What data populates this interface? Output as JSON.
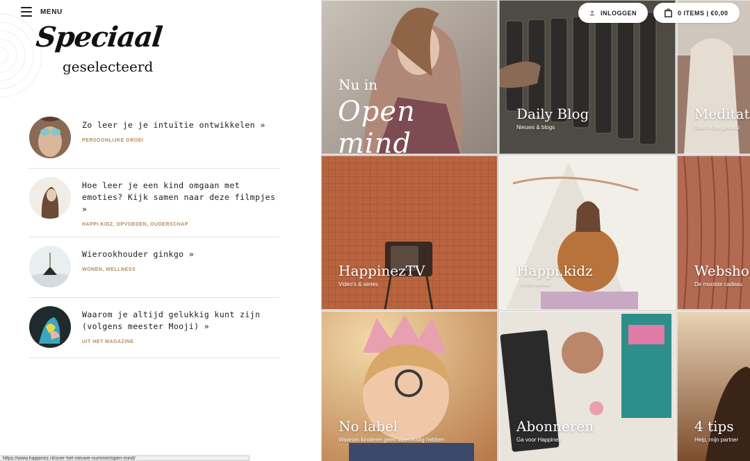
{
  "menu": {
    "label": "MENU"
  },
  "logo": {
    "line1": "Speciaal",
    "line2": "geselecteerd"
  },
  "articles": [
    {
      "title": "Zo leer je je intuïtie ontwikkelen »",
      "tags": "PERSOONLIJKE GROEI"
    },
    {
      "title": "Hoe leer je een kind omgaan met emoties? Kijk samen naar deze filmpjes »",
      "tags": "HAPPI.KIDZ, OPVOEDEN, OUDERSCHAP"
    },
    {
      "title": "Wierookhouder ginkgo »",
      "tags": "WONEN, WELLNESS"
    },
    {
      "title": "Waarom je altijd gelukkig kunt zijn (volgens meester Mooji) »",
      "tags": "UIT HET MAGAZINE"
    }
  ],
  "header": {
    "login_label": "INLOGGEN",
    "cart_label": "0 ITEMS | €0,00"
  },
  "tiles": {
    "open_mind": {
      "line1": "Nu in",
      "line2": "Open mind"
    },
    "daily_blog": {
      "title": "Daily Blog",
      "sub": "Nieuws & blogs"
    },
    "meditatie": {
      "title": "Meditati",
      "sub": "Start nu je gratis p"
    },
    "happinez_tv": {
      "title": "HappinezTV",
      "sub": "Video's & series"
    },
    "happi_kidz": {
      "title": "Happi.kidz",
      "sub": "...in de winkel"
    },
    "webshop": {
      "title": "Webshop",
      "sub": "De mooiste cadeau"
    },
    "no_label": {
      "title": "No label",
      "sub": "Waarom kinderen geen label nodig hebben"
    },
    "abonneren": {
      "title": "Abonneren",
      "sub": "Ga voor Happinez"
    },
    "vier_tips": {
      "title": "4 tips",
      "sub": "Help, mijn partner"
    }
  },
  "status_url": "https://www.happinez.nl/over-het-nieuwe-nummer/open-mind/",
  "colors": {
    "tag_color": "#b58a5c",
    "text": "#1c1c1c"
  }
}
